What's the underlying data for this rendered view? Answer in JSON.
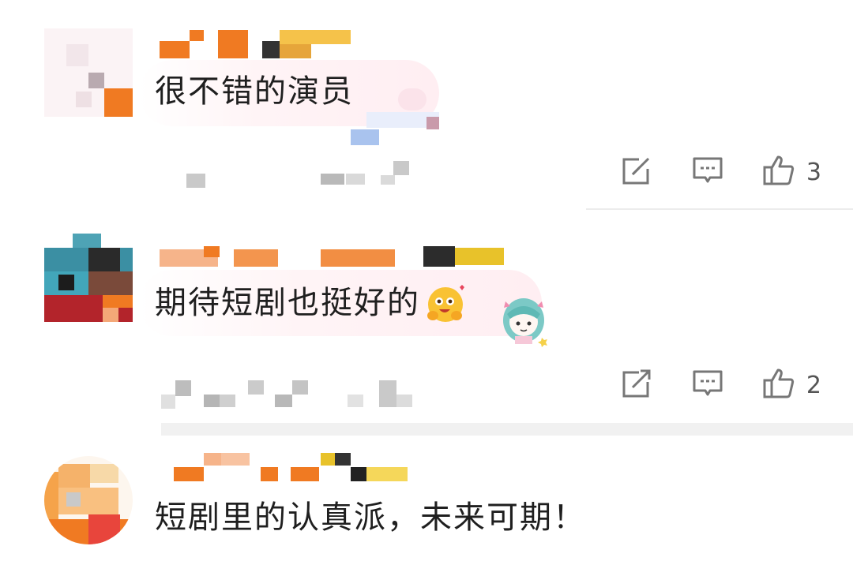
{
  "comments": [
    {
      "text": "很不错的演员",
      "actions": {
        "share_icon": "share-icon",
        "reply_icon": "comment-icon",
        "like_icon": "thumbs-up-icon",
        "like_count": "3"
      }
    },
    {
      "text": "期待短剧也挺好的",
      "actions": {
        "share_icon": "share-icon",
        "reply_icon": "comment-icon",
        "like_icon": "thumbs-up-icon",
        "like_count": "2"
      }
    },
    {
      "text": "短剧里的认真派，未来可期！"
    }
  ],
  "colors": {
    "accent_orange": "#f07a22",
    "icon_gray": "#777777",
    "bubble_pink": "#ffeef2"
  }
}
